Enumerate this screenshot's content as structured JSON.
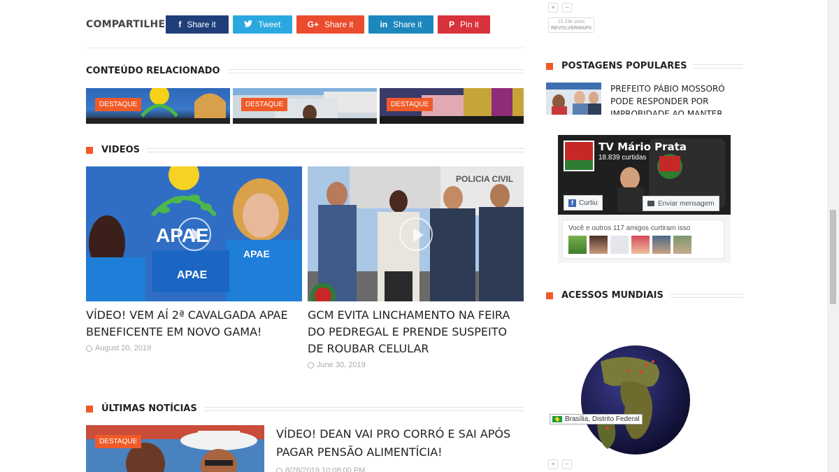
{
  "share": {
    "label": "COMPARTILHE",
    "buttons": [
      {
        "icon": "f",
        "label": "Share it",
        "color": "#1e3f7a",
        "name": "facebook"
      },
      {
        "icon": "🐦",
        "label": "Tweet",
        "color": "#2aa9e0",
        "name": "twitter"
      },
      {
        "icon": "G+",
        "label": "Share it",
        "color": "#ea4c2d",
        "name": "google-plus"
      },
      {
        "icon": "in",
        "label": "Share it",
        "color": "#1d87bd",
        "name": "linkedin"
      },
      {
        "icon": "P",
        "label": "Pin it",
        "color": "#d8323a",
        "name": "pinterest"
      }
    ]
  },
  "related": {
    "heading": "CONTEÚDO RELACIONADO",
    "items": [
      {
        "badge": "DESTAQUE"
      },
      {
        "badge": "DESTAQUE"
      },
      {
        "badge": "DESTAQUE"
      }
    ]
  },
  "videos": {
    "heading": "VIDEOS",
    "items": [
      {
        "title": "VÍDEO! VEM AÍ 2ª CAVALGADA APAE BENEFICENTE EM NOVO GAMA!",
        "date": "August 20, 2019"
      },
      {
        "title": "GCM EVITA LINCHAMENTO NA FEIRA DO PEDREGAL E PRENDE SUSPEITO DE ROUBAR CELULAR",
        "date": "June 30, 2019"
      }
    ]
  },
  "latest": {
    "heading": "ÚLTIMAS NOTÍCIAS",
    "badge": "DESTAQUE",
    "title": "VÍDEO! DEAN VAI PRO CORRÓ E SAI APÓS PAGAR PENSÃO ALIMENTÍCIA!",
    "date": "8/28/2019 10:08:00 PM"
  },
  "sidebar": {
    "revolvermaps_top": {
      "visits": "15.29k visits",
      "brand": "REVOLVERMAPS"
    },
    "popular_heading": "POSTAGENS POPULARES",
    "popular_item": "PREFEITO PÁBIO MOSSORÓ PODE RESPONDER POR IMPROBIDADE AO MANTER NOS",
    "facebook": {
      "page_name": "TV Mário Prata",
      "likes": "18.839 curtidas",
      "like_button": "Curtiu",
      "message_button": "Enviar mensagem",
      "friends_text": "Você e outros 117 amigos curtiram isso"
    },
    "world_heading": "ACESSOS MUNDIAIS",
    "location": "Brasília, Distrito Federal",
    "zoom_in": "+",
    "zoom_out": "−"
  },
  "colors": {
    "accent": "#f05a28"
  }
}
